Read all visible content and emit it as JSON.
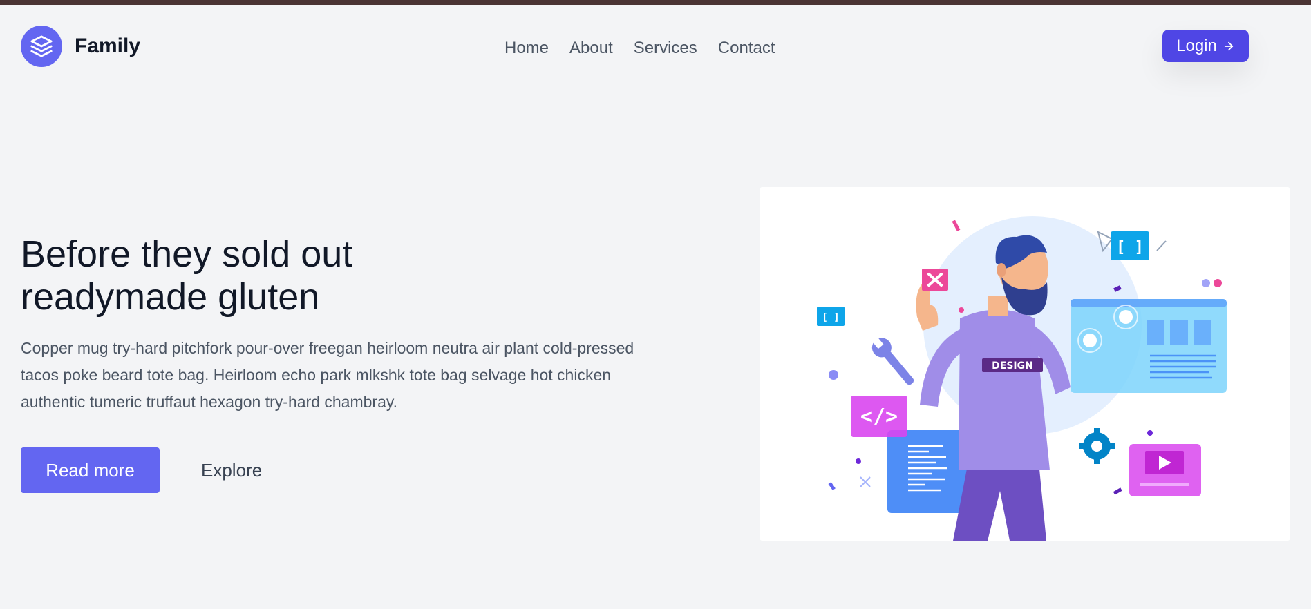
{
  "header": {
    "brand_name": "Family",
    "brand_icon": "layers-icon",
    "nav": [
      "Home",
      "About",
      "Services",
      "Contact"
    ],
    "login_label": "Login",
    "login_icon": "arrow-right-icon"
  },
  "hero": {
    "title_line1": "Before they sold out",
    "title_line2": "readymade gluten",
    "description": "Copper mug try-hard pitchfork pour-over freegan heirloom neutra air plant cold-pressed tacos poke beard tote bag. Heirloom echo park mlkshk tote bag selvage hot chicken authentic tumeric truffaut hexagon try-hard chambray.",
    "primary_button": "Read more",
    "secondary_button": "Explore",
    "illustration": {
      "badge_text": "DESIGN",
      "code_glyph": "</>",
      "bracket_glyph": "[ ]"
    }
  },
  "colors": {
    "accent": "#6366f1",
    "accent_dark": "#4f46e5",
    "background": "#f3f4f6",
    "top_border": "#4a3434"
  }
}
